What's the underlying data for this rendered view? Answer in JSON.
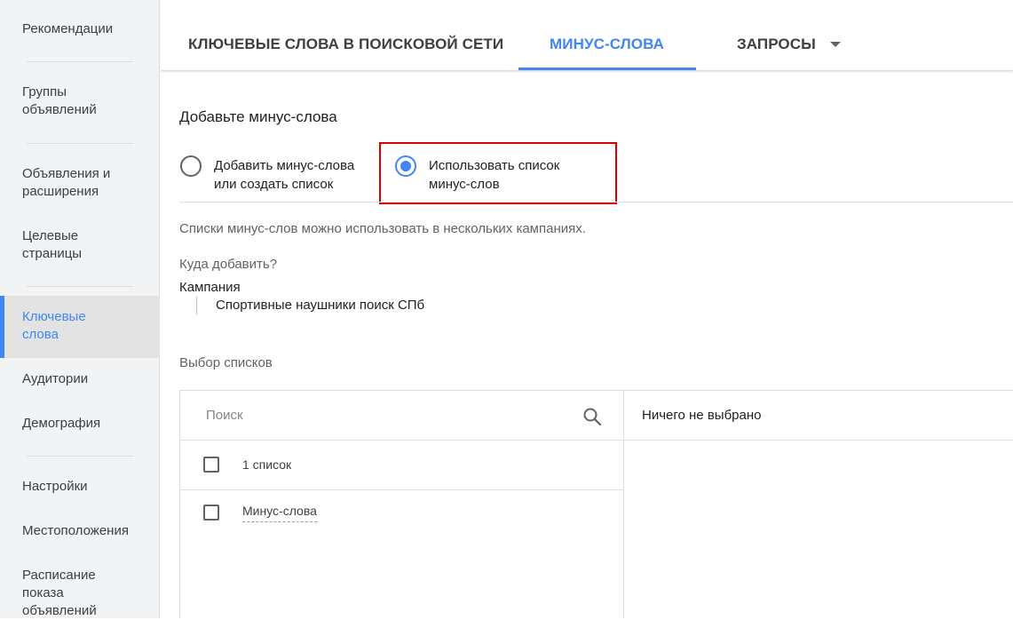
{
  "sidebar": {
    "items": [
      {
        "label": "Рекомендации"
      },
      {
        "label": "Группы объявлений"
      },
      {
        "label": "Объявления и расширения"
      },
      {
        "label": "Целевые страницы"
      },
      {
        "label": "Ключевые слова"
      },
      {
        "label": "Аудитории"
      },
      {
        "label": "Демография"
      },
      {
        "label": "Настройки"
      },
      {
        "label": "Местоположения"
      },
      {
        "label": "Расписание показа объявлений"
      }
    ],
    "active_index": 4
  },
  "tabs": [
    {
      "label": "КЛЮЧЕВЫЕ СЛОВА В ПОИСКОВОЙ СЕТИ"
    },
    {
      "label": "МИНУС-СЛОВА"
    },
    {
      "label": "ЗАПРОСЫ"
    }
  ],
  "form": {
    "heading": "Добавьте минус-слова",
    "option_add": "Добавить минус-слова или создать список",
    "option_use_list": "Использовать список минус-слов",
    "selected_option": "option_use_list",
    "info_text": "Списки минус-слов можно использовать в нескольких кампаниях.",
    "where_label": "Куда добавить?",
    "campaign_label": "Кампания",
    "campaign_name": "Спортивные наушники поиск СПб",
    "lists_label": "Выбор списков"
  },
  "selector": {
    "search_placeholder": "Поиск",
    "list_count": "1 список",
    "rows": [
      {
        "label": "Минус-слова"
      }
    ],
    "right_header": "Ничего не выбрано"
  },
  "colors": {
    "accent": "#4285f4",
    "highlight": "#d50000"
  }
}
